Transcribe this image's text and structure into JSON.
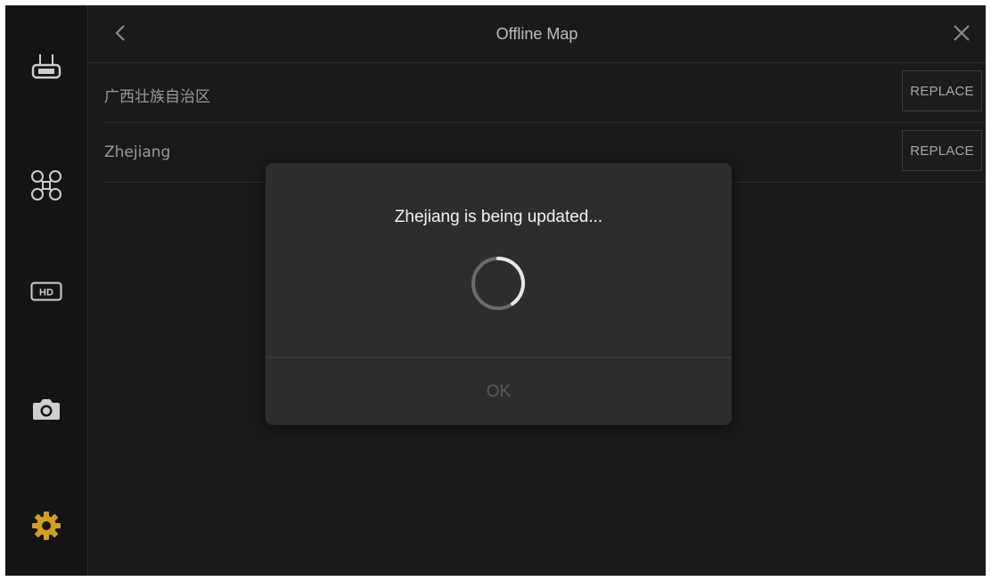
{
  "header": {
    "title": "Offline Map",
    "back_icon": "chevron-left-icon",
    "close_icon": "close-icon"
  },
  "sidebar": {
    "items": [
      {
        "icon": "remote-controller-icon",
        "active": false
      },
      {
        "icon": "aircraft-icon",
        "active": false
      },
      {
        "icon": "hd-transmission-icon",
        "active": false,
        "text": "HD"
      },
      {
        "icon": "camera-icon",
        "active": false
      },
      {
        "icon": "gear-icon",
        "active": true
      }
    ],
    "active_color": "#d4a017"
  },
  "maps": [
    {
      "name": "广西壮族自治区",
      "action": "REPLACE"
    },
    {
      "name": "Zhejiang",
      "action": "REPLACE"
    }
  ],
  "dialog": {
    "message": "Zhejiang is being updated...",
    "ok_label": "OK",
    "spinner_icon": "loading-spinner-icon"
  }
}
